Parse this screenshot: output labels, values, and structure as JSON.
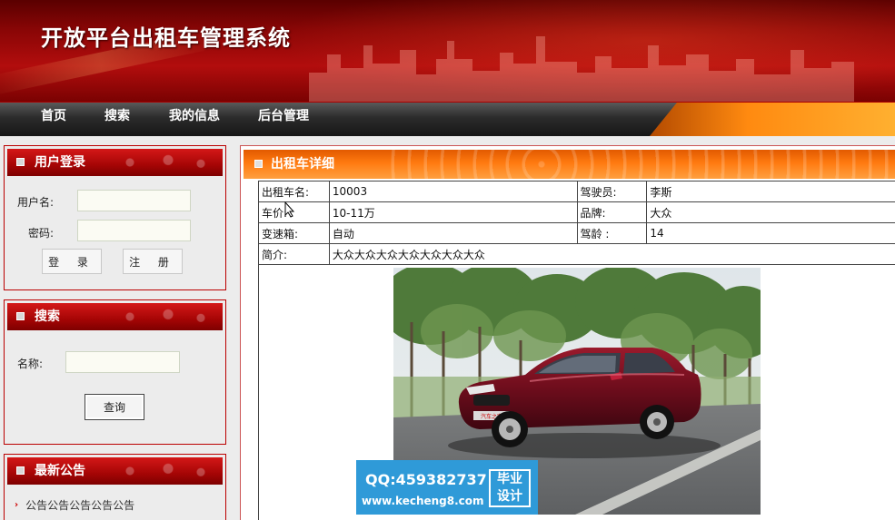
{
  "header": {
    "title": "开放平台出租车管理系统"
  },
  "nav": {
    "items": [
      "首页",
      "搜索",
      "我的信息",
      "后台管理"
    ]
  },
  "login": {
    "title": "用户登录",
    "username_label": "用户名:",
    "password_label": "密码:",
    "login_button": "登 录",
    "register_button": "注 册"
  },
  "search": {
    "title": "搜索",
    "name_label": "名称:",
    "query_button": "查询"
  },
  "notice": {
    "title": "最新公告",
    "items": [
      "公告公告公告公告公告"
    ]
  },
  "detail": {
    "title": "出租车详细",
    "rows": [
      {
        "l1": "出租车名:",
        "v1": "10003",
        "l2": "驾驶员:",
        "v2": "李斯"
      },
      {
        "l1": "车价:",
        "v1": "10-11万",
        "l2": "品牌:",
        "v2": "大众"
      },
      {
        "l1": "变速箱:",
        "v1": "自动",
        "l2": "驾龄  :",
        "v2": "14"
      }
    ],
    "intro_label": "简介:",
    "intro_value": "大众大众大众大众大众大众大众",
    "image_plate": "汽车之家"
  },
  "watermark": {
    "qq": "QQ:459382737",
    "url": "www.kecheng8.com",
    "tag_line1": "毕业",
    "tag_line2": "设计"
  },
  "colors": {
    "banner_red": "#a50505",
    "nav_dark": "#222222",
    "accent_orange": "#ff7a10",
    "watermark_blue": "#2f9ad8"
  }
}
